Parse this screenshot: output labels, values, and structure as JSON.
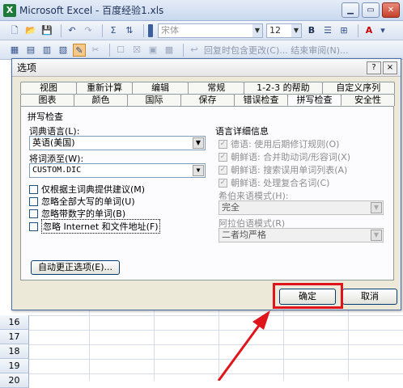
{
  "excel": {
    "title": "Microsoft Excel - 百度经验1.xls",
    "font_name": "宋体",
    "font_size": "12",
    "bold_label": "B",
    "review_text": "回复时包含更改(C)... 结束审阅(N)...",
    "app_icon_letter": "X"
  },
  "sheet": {
    "rows": [
      "16",
      "17",
      "18",
      "19",
      "20"
    ]
  },
  "dialog": {
    "title": "选项",
    "help_btn": "?",
    "close_btn": "×",
    "tabs_row1": [
      "视图",
      "重新计算",
      "编辑",
      "常规",
      "1-2-3 的帮助",
      "自定义序列"
    ],
    "tabs_row2": [
      "图表",
      "颜色",
      "国际",
      "保存",
      "错误检查",
      "拼写检查",
      "安全性"
    ],
    "active_tab": "拼写检查",
    "section_title": "拼写检查",
    "dict_lang_label": "词典语言(L):",
    "dict_lang_value": "英语(美国)",
    "add_word_label": "将词添至(W):",
    "add_word_value": "CUSTOM.DIC",
    "checkboxes": [
      {
        "label": "仅根据主词典提供建议(M)",
        "checked": false
      },
      {
        "label": "忽略全部大写的单词(U)",
        "checked": false
      },
      {
        "label": "忽略带数字的单词(B)",
        "checked": false
      },
      {
        "label": "忽略 Internet 和文件地址(F)",
        "checked": false
      }
    ],
    "autocorrect_btn": "自动更正选项(E)...",
    "lang_detail_title": "语言详细信息",
    "lang_detail_checks": [
      {
        "label": "德语: 使用后期修订规则(O)",
        "checked": true
      },
      {
        "label": "朝鲜语: 合并助动词/形容词(X)",
        "checked": true
      },
      {
        "label": "朝鲜语: 搜索误用单词列表(A)",
        "checked": true
      },
      {
        "label": "朝鲜语: 处理复合名词(C)",
        "checked": true
      }
    ],
    "hebrew_label": "希伯来语模式(H):",
    "hebrew_value": "完全",
    "arabic_label": "阿拉伯语模式(R)",
    "arabic_value": "二者均严格",
    "ok_btn": "确定",
    "cancel_btn": "取消"
  },
  "colors": {
    "highlight": "#e0151b",
    "dialog_bg": "#ece9d8"
  }
}
